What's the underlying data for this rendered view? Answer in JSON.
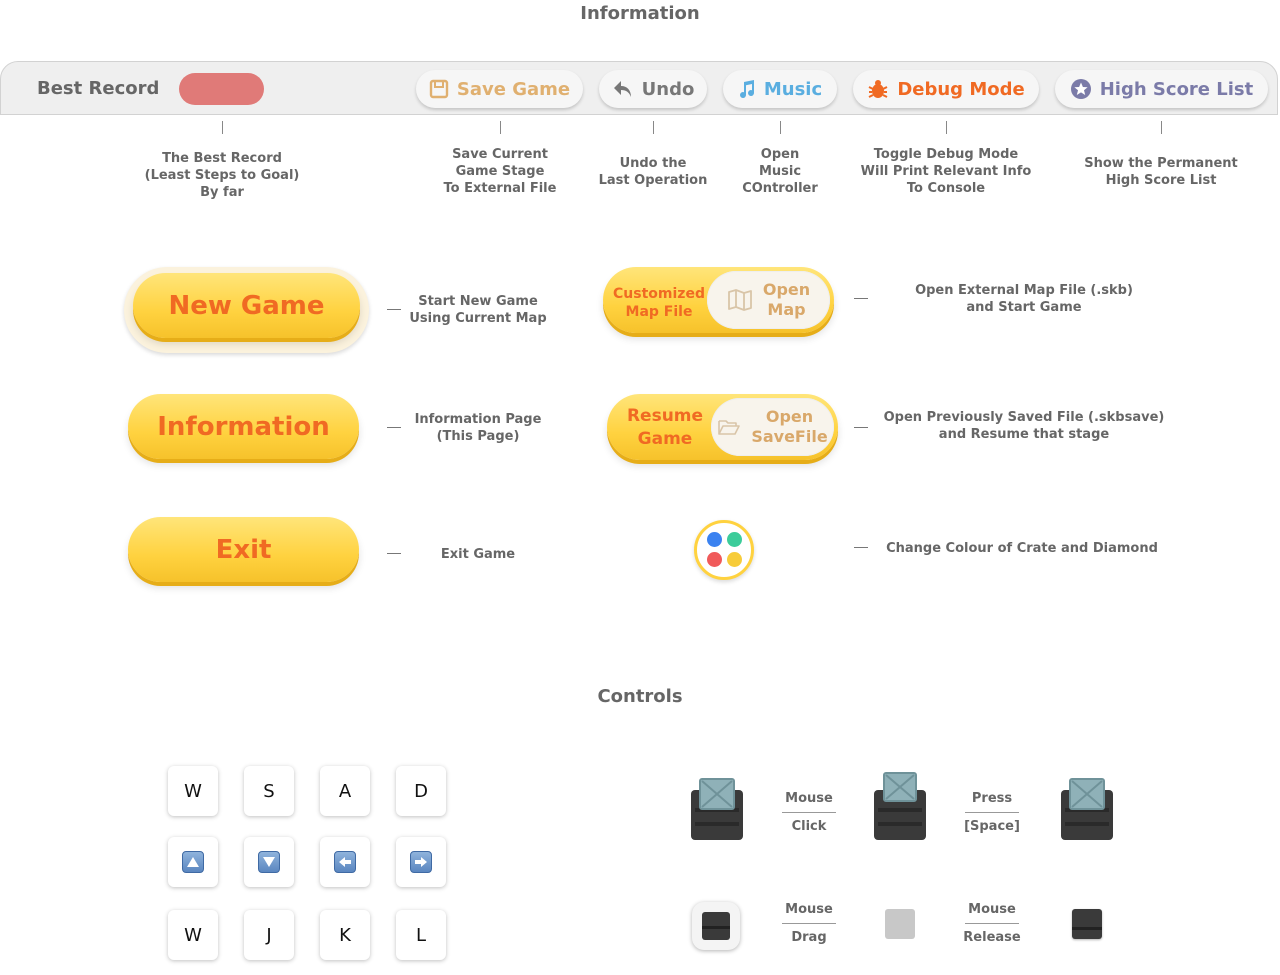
{
  "page": {
    "heading": "Information",
    "controls_heading": "Controls"
  },
  "toolbar": {
    "best_record_label": "Best Record",
    "save_game": "Save Game",
    "undo": "Undo",
    "music": "Music",
    "debug_mode": "Debug Mode",
    "high_score_list": "High Score List",
    "colors": {
      "save": "#e0b070",
      "undo": "#777777",
      "music": "#5aaee0",
      "debug": "#f06a23",
      "highscore": "#7b7ba8",
      "best_pill": "#e07a78"
    }
  },
  "toolbar_desc": {
    "best": [
      "The Best Record",
      "(Least Steps to Goal)",
      "By far"
    ],
    "save": [
      "Save Current",
      "Game Stage",
      "To External File"
    ],
    "undo": [
      "Undo the",
      "Last Operation"
    ],
    "music": [
      "Open",
      "Music",
      "COntroller"
    ],
    "debug": [
      "Toggle Debug Mode",
      "Will Print Relevant Info",
      "To Console"
    ],
    "highscore": [
      "Show the Permanent",
      "High Score List"
    ]
  },
  "menu": {
    "new_game": {
      "label": "New Game",
      "desc": [
        "Start New Game",
        "Using Current Map"
      ]
    },
    "information": {
      "label": "Information",
      "desc": [
        "Information Page",
        "(This Page)"
      ]
    },
    "exit": {
      "label": "Exit",
      "desc": [
        "Exit Game"
      ]
    },
    "customized_map": {
      "left": [
        "Customized",
        "Map File"
      ],
      "right": [
        "Open",
        "Map"
      ],
      "desc": [
        "Open External Map File (.skb)",
        "and Start Game"
      ]
    },
    "resume": {
      "left": [
        "Resume",
        "Game"
      ],
      "right": [
        "Open",
        "SaveFile"
      ],
      "desc": [
        "Open Previously Saved File (.skbsave)",
        "and Resume that stage"
      ]
    },
    "colour": {
      "desc": [
        "Change Colour of Crate and Diamond"
      ],
      "dots": [
        "#3b82f0",
        "#3ccc9a",
        "#f05a5a",
        "#f7cc3a"
      ]
    }
  },
  "keys": {
    "row1": [
      "W",
      "S",
      "A",
      "D"
    ],
    "row2_icons": [
      "up-arrow-icon",
      "down-arrow-icon",
      "left-arrow-icon",
      "right-arrow-icon"
    ],
    "row3": [
      "W",
      "J",
      "K",
      "L"
    ]
  },
  "controls": {
    "click": [
      "Mouse",
      "Click"
    ],
    "space": [
      "Press",
      "[Space]"
    ],
    "drag": [
      "Mouse",
      "Drag"
    ],
    "release": [
      "Mouse",
      "Release"
    ]
  }
}
